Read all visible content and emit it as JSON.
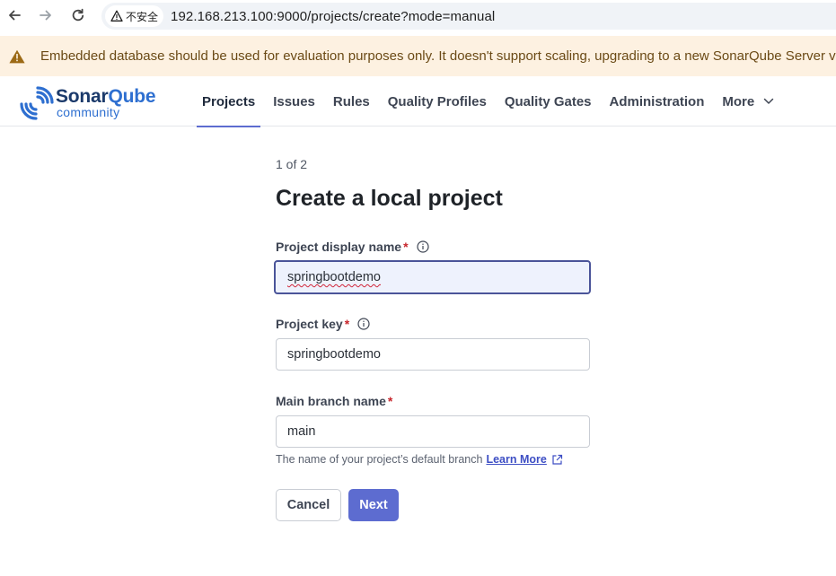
{
  "browser": {
    "back_icon": "arrow-left-icon",
    "forward_icon": "arrow-right-icon",
    "reload_icon": "reload-icon",
    "security_label": "不安全",
    "url": "192.168.213.100:9000/projects/create?mode=manual"
  },
  "banner": {
    "icon": "warning-triangle-icon",
    "text": "Embedded database should be used for evaluation purposes only. It doesn't support scaling, upgrading to a new SonarQube Server ve",
    "color": "#fdf1e1"
  },
  "header": {
    "logo": {
      "name_part1": "Sonar",
      "name_part2": "Qube",
      "subtitle": "community"
    },
    "nav": [
      {
        "label": "Projects",
        "active": true
      },
      {
        "label": "Issues",
        "active": false
      },
      {
        "label": "Rules",
        "active": false
      },
      {
        "label": "Quality Profiles",
        "active": false
      },
      {
        "label": "Quality Gates",
        "active": false
      },
      {
        "label": "Administration",
        "active": false
      },
      {
        "label": "More",
        "active": false
      }
    ],
    "accent": "#5d6cd0"
  },
  "form": {
    "step": "1 of 2",
    "title": "Create a local project",
    "display_name": {
      "label": "Project display name",
      "required_mark": "*",
      "value": "springbootdemo"
    },
    "project_key": {
      "label": "Project key",
      "required_mark": "*",
      "value": "springbootdemo"
    },
    "main_branch": {
      "label": "Main branch name",
      "required_mark": "*",
      "value": "main"
    },
    "help_text": "The name of your project’s default branch",
    "learn_more": "Learn More",
    "cancel_label": "Cancel",
    "next_label": "Next"
  }
}
